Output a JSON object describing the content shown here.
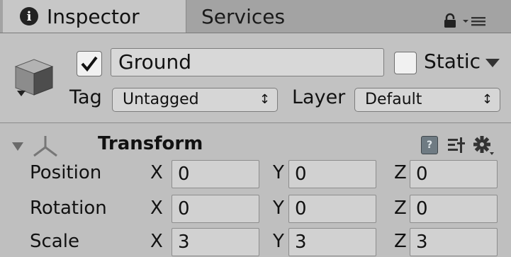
{
  "tabs": {
    "inspector": "Inspector",
    "services": "Services"
  },
  "object": {
    "name": "Ground",
    "active": true,
    "static_label": "Static",
    "static_checked": false,
    "tag_label": "Tag",
    "tag_value": "Untagged",
    "layer_label": "Layer",
    "layer_value": "Default"
  },
  "transform": {
    "title": "Transform",
    "help_glyph": "?",
    "axis_labels": {
      "x": "X",
      "y": "Y",
      "z": "Z"
    },
    "rows": [
      {
        "label": "Position",
        "x": "0",
        "y": "0",
        "z": "0"
      },
      {
        "label": "Rotation",
        "x": "0",
        "y": "0",
        "z": "0"
      },
      {
        "label": "Scale",
        "x": "3",
        "y": "3",
        "z": "3"
      }
    ]
  },
  "icons": {
    "info": "info-icon",
    "lock": "lock-icon",
    "menu": "menu-icon",
    "gameobject": "cube-icon",
    "dropdown_arrow": "arrow-down-icon",
    "fold": "fold-arrow-icon",
    "transform": "transform-axes-icon",
    "help": "help-icon",
    "preset": "preset-icon",
    "settings": "gear-icon"
  },
  "colors": {
    "panel": "#c2c2c2",
    "tab_bar": "#a3a3a3",
    "field": "#d1d1d1"
  }
}
